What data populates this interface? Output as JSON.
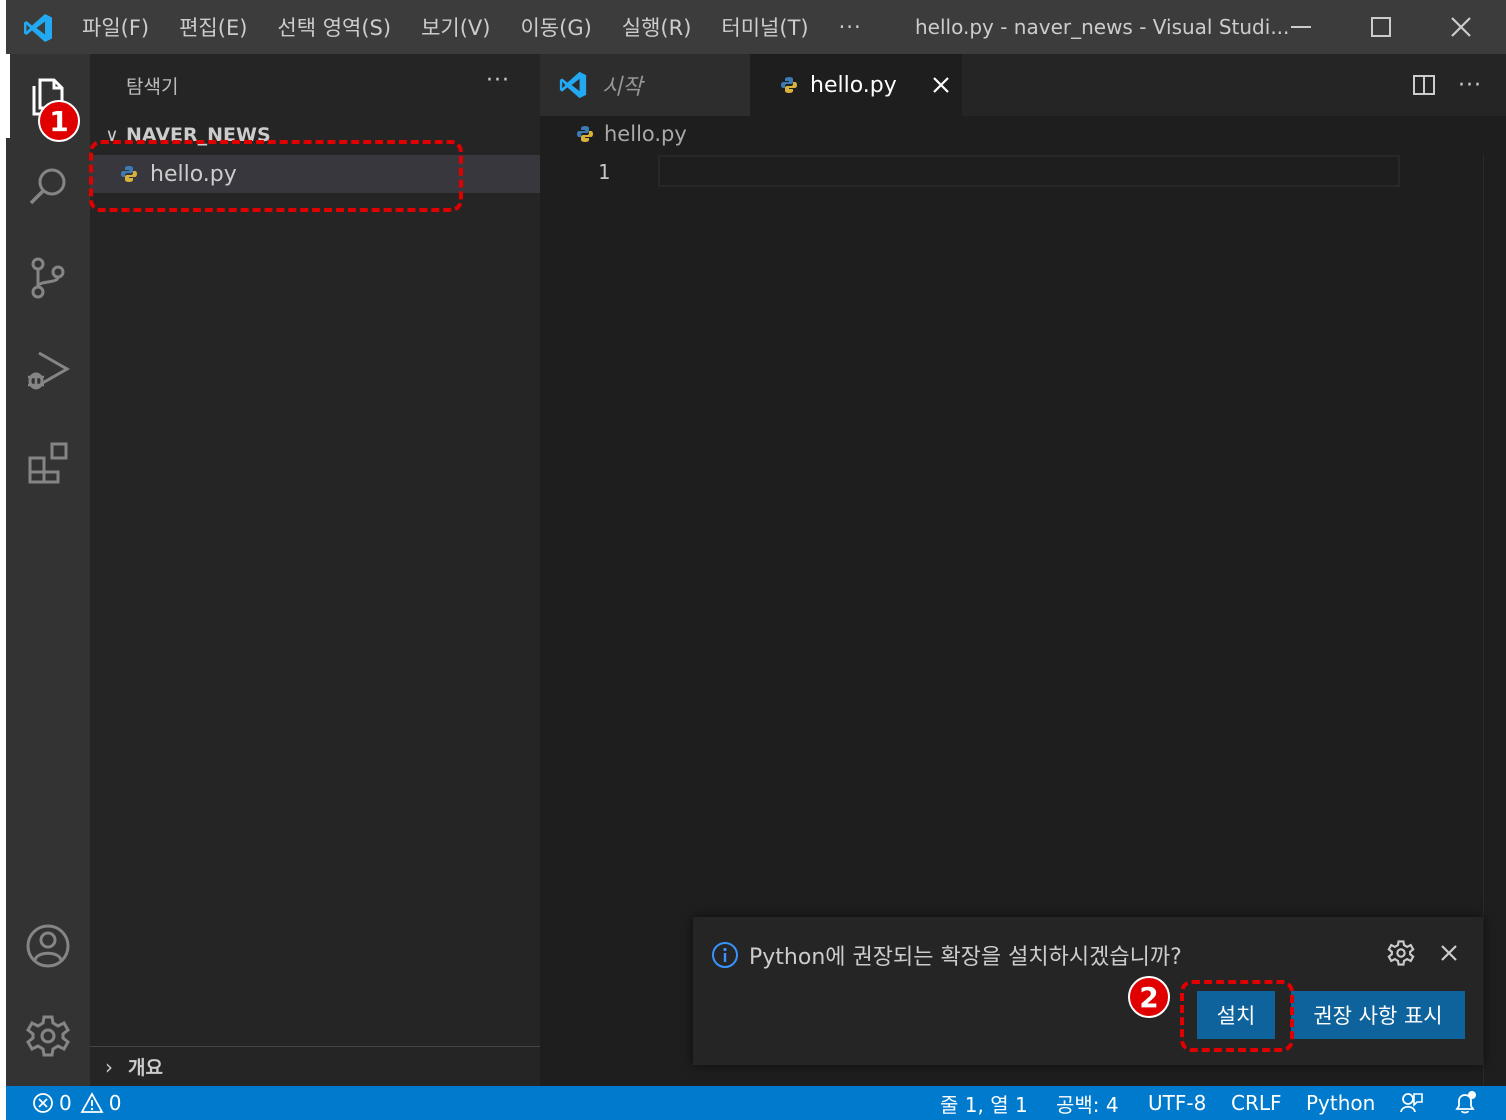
{
  "titlebar": {
    "menu": [
      "파일(F)",
      "편집(E)",
      "선택 영역(S)",
      "보기(V)",
      "이동(G)",
      "실행(R)",
      "터미널(T)"
    ],
    "more": "···",
    "title": "hello.py - naver_news - Visual Studi..."
  },
  "sidebar": {
    "title": "탐색기",
    "more": "···",
    "folder": "NAVER_NEWS",
    "files": [
      "hello.py"
    ],
    "outline": "개요"
  },
  "editor": {
    "tabs": [
      {
        "label": "시작",
        "icon": "vscode-logo-icon"
      },
      {
        "label": "hello.py",
        "icon": "python-icon"
      }
    ],
    "breadcrumb": "hello.py",
    "line_numbers": [
      "1"
    ]
  },
  "notification": {
    "message": "Python에 권장되는 확장을 설치하시겠습니까?",
    "install_label": "설치",
    "show_label": "권장 사항 표시"
  },
  "statusbar": {
    "errors": "0",
    "warnings": "0",
    "position": "줄 1, 열 1",
    "spaces": "공백: 4",
    "encoding": "UTF-8",
    "eol": "CRLF",
    "language": "Python"
  },
  "annotations": {
    "step1": "1",
    "step2": "2"
  },
  "colors": {
    "accent": "#007acc",
    "button": "#0e639c",
    "highlight": "#e00000",
    "python_blue": "#3d7ab3",
    "python_yellow": "#d8b23b"
  }
}
